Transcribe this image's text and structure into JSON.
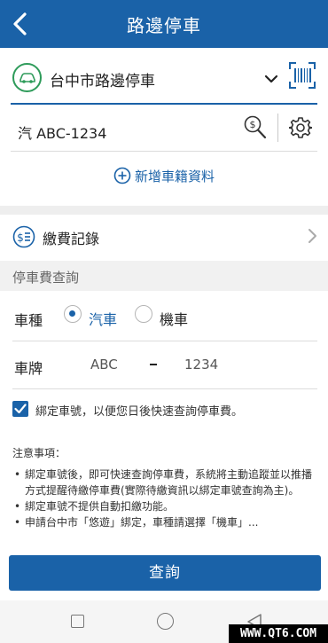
{
  "header": {
    "title": "路邊停車"
  },
  "city": {
    "name": "台中市路邊停車"
  },
  "plate": {
    "display": "汽 ABC-1234"
  },
  "add_vehicle": {
    "label": "新增車籍資料"
  },
  "records": {
    "label": "繳費記錄"
  },
  "query_section": {
    "title": "停車費查詢"
  },
  "vehicle_type": {
    "label": "車種",
    "options": [
      {
        "label": "汽車",
        "selected": true
      },
      {
        "label": "機車",
        "selected": false
      }
    ]
  },
  "plate_input": {
    "label": "車牌",
    "part1": "ABC",
    "part2": "1234"
  },
  "bind": {
    "checked": true,
    "text": "綁定車號，以便您日後快速查詢停車費。"
  },
  "notes": {
    "title": "注意事項：",
    "items": [
      "綁定車號後，即可快速查詢停車費，系統將主動追蹤並以推播方式提醒待繳停車費(實際待繳資訊以綁定車號查詢為主)。",
      "綁定車號不提供自動扣繳功能。",
      "申請台中市「悠遊」綁定，車種請選擇「機車」..."
    ]
  },
  "submit": {
    "label": "查詢"
  },
  "watermark": {
    "text": "WWW.QT6.COM"
  },
  "colors": {
    "primary": "#1a62a8",
    "accent_green": "#2e9b5a"
  }
}
